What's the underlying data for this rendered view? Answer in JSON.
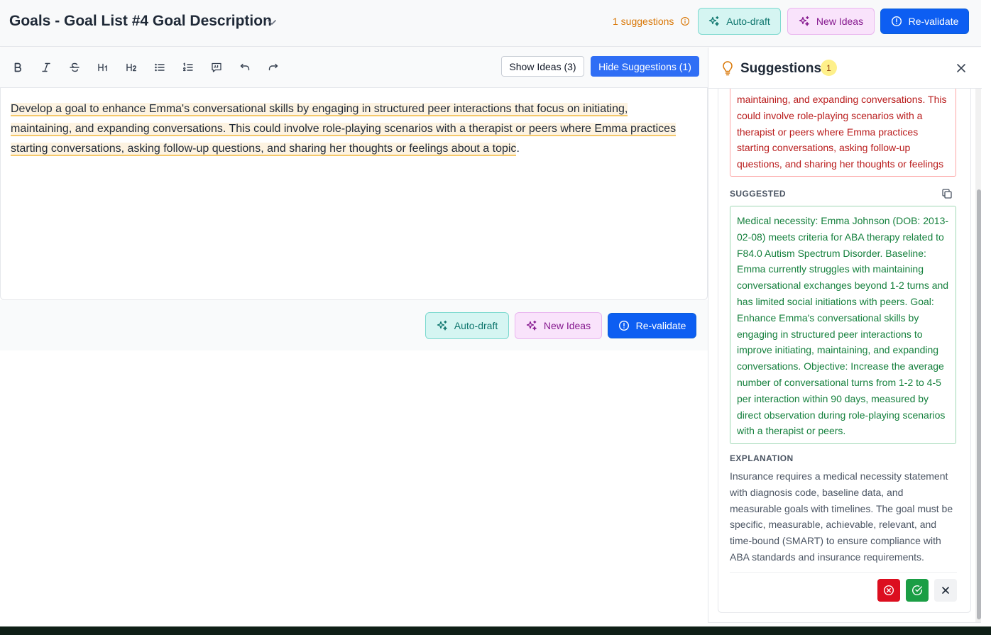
{
  "header": {
    "title": "Goals - Goal List #4 Goal Description",
    "suggestion_count": "1 suggestions",
    "autodraft_label": "Auto-draft",
    "newideas_label": "New Ideas",
    "revalidate_label": "Re-validate"
  },
  "toolbar": {
    "bold": "B",
    "italic": "I",
    "strike": "S",
    "h1": "H1",
    "h2": "H2",
    "show_ideas_label": "Show Ideas (3)",
    "hide_suggestions_label": "Hide Suggestions (1)"
  },
  "editor": {
    "text": "Develop a goal to enhance Emma's conversational skills by engaging in structured peer interactions that focus on initiating, maintaining, and expanding conversations. This could involve role-playing scenarios with a therapist or peers where Emma practices starting conversations, asking follow-up questions, and sharing her thoughts or feelings about a topic",
    "trailing": "."
  },
  "actions": {
    "autodraft_label": "Auto-draft",
    "newideas_label": "New Ideas",
    "revalidate_label": "Re-validate"
  },
  "panel": {
    "title": "Suggestions",
    "badge": "1",
    "original_text": "maintaining, and expanding conversations. This could involve role-playing scenarios with a therapist or peers where Emma practices starting conversations, asking follow-up questions, and sharing her thoughts or feelings about a topic.",
    "suggested_label": "SUGGESTED",
    "suggested_text": "Medical necessity: Emma Johnson (DOB: 2013-02-08) meets criteria for ABA therapy related to F84.0 Autism Spectrum Disorder. Baseline: Emma currently struggles with maintaining conversational exchanges beyond 1-2 turns and has limited social initiations with peers. Goal: Enhance Emma's conversational skills by engaging in structured peer interactions to improve initiating, maintaining, and expanding conversations. Objective: Increase the average number of conversational turns from 1-2 to 4-5 per interaction within 90 days, measured by direct observation during role-playing scenarios with a therapist or peers.",
    "explanation_label": "EXPLANATION",
    "explanation_text": "Insurance requires a medical necessity statement with diagnosis code, baseline data, and measurable goals with timelines. The goal must be specific, measurable, achievable, relevant, and time-bound (SMART) to ensure compliance with ABA standards and insurance requirements."
  },
  "colors": {
    "teal_bg": "#d5f5f2",
    "purple_bg": "#f9e3fb",
    "primary_blue": "#0d5ef2",
    "warning_amber": "#d97706",
    "reject_red": "#dc0e1f",
    "accept_green": "#1b9e45"
  },
  "icons": [
    "chevron-down-icon",
    "info-icon",
    "sparkles-icon",
    "alert-circle-icon",
    "bold-icon",
    "italic-icon",
    "strikethrough-icon",
    "h1-icon",
    "h2-icon",
    "bullet-list-icon",
    "ordered-list-icon",
    "quote-icon",
    "undo-icon",
    "redo-icon",
    "lightbulb-icon",
    "close-icon",
    "copy-icon",
    "x-circle-icon",
    "check-circle-icon",
    "x-icon"
  ]
}
